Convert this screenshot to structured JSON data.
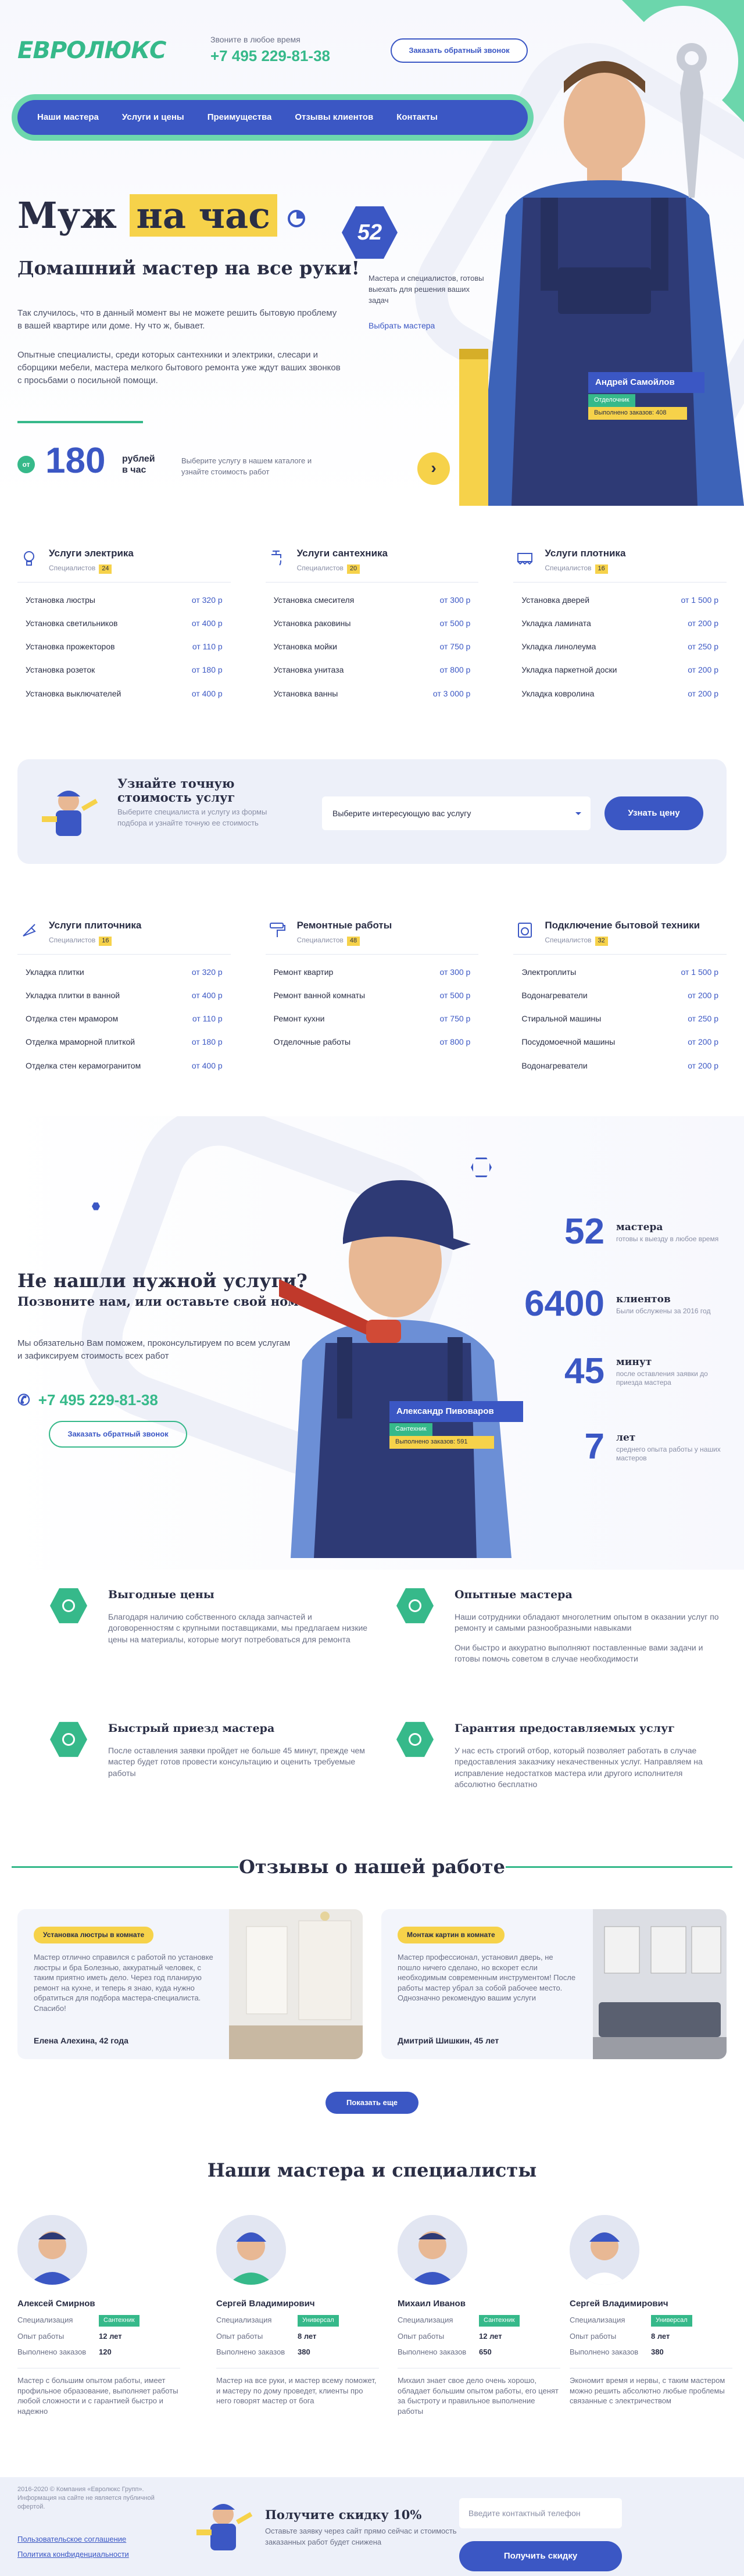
{
  "header": {
    "logo": "ЕВРОЛЮКС",
    "call_hint": "Звоните в любое время",
    "phone": "+7 495 229-81-38",
    "callback_label": "Заказать обратный звонок",
    "nav": [
      "Наши мастера",
      "Услуги и цены",
      "Преимущества",
      "Отзывы клиентов",
      "Контакты"
    ]
  },
  "hero": {
    "title_part1": "Муж",
    "title_part2": "на час",
    "subtitle": "Домашний мастер на все руки!",
    "p1": "Так случилось, что в данный момент вы не можете решить бытовую проблему в вашей квартире или доме. Ну что ж, бывает.",
    "p2": "Опытные специалисты, среди которых сантехники и электрики, слесари и сборщики мебели, мастера мелкого бытового ремонта уже ждут ваших звонков с просьбами о посильной помощи.",
    "price_badge": "от",
    "price": "180",
    "price_unit_1": "рублей",
    "price_unit_2": "в час",
    "price_note": "Выберите услугу в нашем каталоге и узнайте стоимость работ",
    "masters_count": "52",
    "masters_text": "Мастера и специалистов, готовы выехать для решения ваших задач",
    "masters_link": "Выбрать мастера",
    "worker_name": "Андрей Самойлов",
    "worker_tag": "Отделочник",
    "worker_orders": "Выполнено заказов: 408",
    "arrow": "›"
  },
  "services1": [
    {
      "title": "Услуги электрика",
      "spec_label": "Специалистов",
      "count": "24",
      "icon": "lamp-icon",
      "rows": [
        [
          "Установка люстры",
          "от 320 р"
        ],
        [
          "Установка светильников",
          "от 400 р"
        ],
        [
          "Установка прожекторов",
          "от 110 р"
        ],
        [
          "Установка розеток",
          "от 180 р"
        ],
        [
          "Установка выключателей",
          "от 400 р"
        ]
      ]
    },
    {
      "title": "Услуги сантехника",
      "spec_label": "Специалистов",
      "count": "20",
      "icon": "faucet-icon",
      "rows": [
        [
          "Установка смесителя",
          "от 300 р"
        ],
        [
          "Установка раковины",
          "от 500 р"
        ],
        [
          "Установка мойки",
          "от 750 р"
        ],
        [
          "Установка унитаза",
          "от 800 р"
        ],
        [
          "Установка ванны",
          "от 3 000 р"
        ]
      ]
    },
    {
      "title": "Услуги плотника",
      "spec_label": "Специалистов",
      "count": "16",
      "icon": "saw-icon",
      "rows": [
        [
          "Установка дверей",
          "от 1 500 р"
        ],
        [
          "Укладка ламината",
          "от 200 р"
        ],
        [
          "Укладка линолеума",
          "от 250 р"
        ],
        [
          "Укладка паркетной доски",
          "от 200 р"
        ],
        [
          "Укладка ковролина",
          "от 200 р"
        ]
      ]
    }
  ],
  "cost": {
    "title": "Узнайте точную стоимость услуг",
    "desc": "Выберите специалиста и услугу из формы подбора и узнайте точную ее стоимость",
    "select_placeholder": "Выберите интересующую вас услугу",
    "button": "Узнать цену"
  },
  "services2": [
    {
      "title": "Услуги плиточника",
      "spec_label": "Специалистов",
      "count": "16",
      "icon": "trowel-icon",
      "rows": [
        [
          "Укладка плитки",
          "от 320 р"
        ],
        [
          "Укладка плитки в ванной",
          "от 400 р"
        ],
        [
          "Отделка стен мрамором",
          "от 110 р"
        ],
        [
          "Отделка мраморной плиткой",
          "от 180 р"
        ],
        [
          "Отделка стен керамогранитом",
          "от 400 р"
        ]
      ]
    },
    {
      "title": "Ремонтные работы",
      "spec_label": "Специалистов",
      "count": "48",
      "icon": "roller-icon",
      "rows": [
        [
          "Ремонт квартир",
          "от 300 р"
        ],
        [
          "Ремонт ванной комнаты",
          "от 500 р"
        ],
        [
          "Ремонт кухни",
          "от 750 р"
        ],
        [
          "Отделочные работы",
          "от 800 р"
        ]
      ]
    },
    {
      "title": "Подключение бытовой техники",
      "spec_label": "Специалистов",
      "count": "32",
      "icon": "washer-icon",
      "rows": [
        [
          "Электроплиты",
          "от 1 500 р"
        ],
        [
          "Водонагреватели",
          "от 200 р"
        ],
        [
          "Стиральной машины",
          "от 250 р"
        ],
        [
          "Посудомоечной машины",
          "от 200 р"
        ],
        [
          "Водонагреватели",
          "от 200 р"
        ]
      ]
    }
  ],
  "notfound": {
    "title": "Не нашли нужной услуги?",
    "subtitle": "Позвоните нам, или оставьте свой номер",
    "desc": "Мы обязательно Вам поможем, проконсультируем по всем услугам и зафиксируем стоимость всех работ",
    "phone": "+7 495 229-81-38",
    "button": "Заказать обратный звонок",
    "worker_name": "Александр Пивоваров",
    "worker_tag": "Сантехник",
    "worker_orders": "Выполнено заказов: 591"
  },
  "stats": [
    {
      "value": "52",
      "label": "мастера",
      "desc": "готовы к выезду в любое время"
    },
    {
      "value": "6400",
      "label": "клиентов",
      "desc": "Были обслужены за 2016 год"
    },
    {
      "value": "45",
      "label": "минут",
      "desc": "после оставления заявки до приезда мастера"
    },
    {
      "value": "7",
      "label": "лет",
      "desc": "среднего опыта работы у наших мастеров"
    }
  ],
  "features": [
    {
      "title": "Выгодные цены",
      "p": "Благодаря наличию собственного склада запчастей и договоренностям с крупными поставщиками, мы предлагаем низкие цены на материалы, которые могут потребоваться для ремонта"
    },
    {
      "title": "Опытные мастера",
      "p": "Наши сотрудники обладают многолетним опытом в оказании услуг по ремонту и самыми разнообразными навыками",
      "p2": "Они быстро и аккуратно выполняют поставленные вами задачи и готовы помочь советом в случае необходимости"
    },
    {
      "title": "Быстрый приезд мастера",
      "p": "После оставления заявки пройдет не больше 45 минут, прежде чем мастер будет готов провести консультацию и оценить требуемые работы"
    },
    {
      "title": "Гарантия предоставляемых услуг",
      "p": "У нас есть строгий отбор, который позволяет работать в случае предоставления заказчику некачественных услуг. Направляем на исправление недостатков мастера или другого исполнителя абсолютно бесплатно"
    }
  ],
  "reviews": {
    "title": "Отзывы о нашей работе",
    "items": [
      {
        "tag": "Установка люстры в комнате",
        "text": "Мастер отлично справился с работой по установке люстры и бра Болезнью, аккуратный человек, с таким приятно иметь дело. Через год планирую ремонт на кухне, и теперь я знаю, куда нужно обратиться для подбора мастера-специалиста. Спасибо!",
        "author": "Елена Алехина, 42 года"
      },
      {
        "tag": "Монтаж картин в комнате",
        "text": "Мастер профессионал, установил дверь, не пошло ничего сделано, но вскорет если необходимым современным инструментом! После работы мастер убрал за собой рабочее место. Однозначно рекомендую вашим услуги",
        "author": "Дмитрий Шишкин, 45 лет"
      }
    ],
    "more": "Показать еще"
  },
  "masters": {
    "title": "Наши мастера и специалисты",
    "items": [
      {
        "name": "Алексей Смирнов",
        "k1": "Специализация",
        "badge": "Сантехник",
        "k2": "Опыт работы",
        "exp": "12 лет",
        "k3": "Выполнено заказов",
        "orders": "120",
        "bio": "Мастер с большим опытом работы, имеет профильное образование, выполняет работы любой сложности и с гарантией быстро и надежно"
      },
      {
        "name": "Сергей Владимирович",
        "k1": "Специализация",
        "badge": "Универсал",
        "k2": "Опыт работы",
        "exp": "8 лет",
        "k3": "Выполнено заказов",
        "orders": "380",
        "bio": "Мастер на все руки, и мастер всему поможет, и мастеру по дому проведет, клиенты про него говорят мастер от бога"
      },
      {
        "name": "Михаил Иванов",
        "k1": "Специализация",
        "badge": "Сантехник",
        "k2": "Опыт работы",
        "exp": "12 лет",
        "k3": "Выполнено заказов",
        "orders": "650",
        "bio": "Михаил знает свое дело очень хорошо, обладает большим опытом работы, его ценят за быстроту и правильное выполнение работы"
      },
      {
        "name": "Сергей Владимирович",
        "k1": "Специализация",
        "badge": "Универсал",
        "k2": "Опыт работы",
        "exp": "8 лет",
        "k3": "Выполнено заказов",
        "orders": "380",
        "bio": "Экономит время и нервы, с таким мастером можно решить абсолютно любые проблемы связанные с электричеством"
      }
    ]
  },
  "footer": {
    "copyright": "2016-2020 © Компания «Евролюкс Групп». Информация на сайте не является публичной офертой.",
    "link1": "Пользовательское соглашение",
    "link2": "Политика конфиденциальности",
    "discount_title": "Получите скидку 10%",
    "discount_desc": "Оставьте заявку через сайт прямо сейчас и стоимость заказанных работ будет снижена",
    "input_placeholder": "Введите контактный телефон",
    "button": "Получить скидку"
  },
  "colors": {
    "brand_blue": "#3b57c4",
    "brand_green": "#36b98a",
    "accent_yellow": "#f6d24a"
  }
}
